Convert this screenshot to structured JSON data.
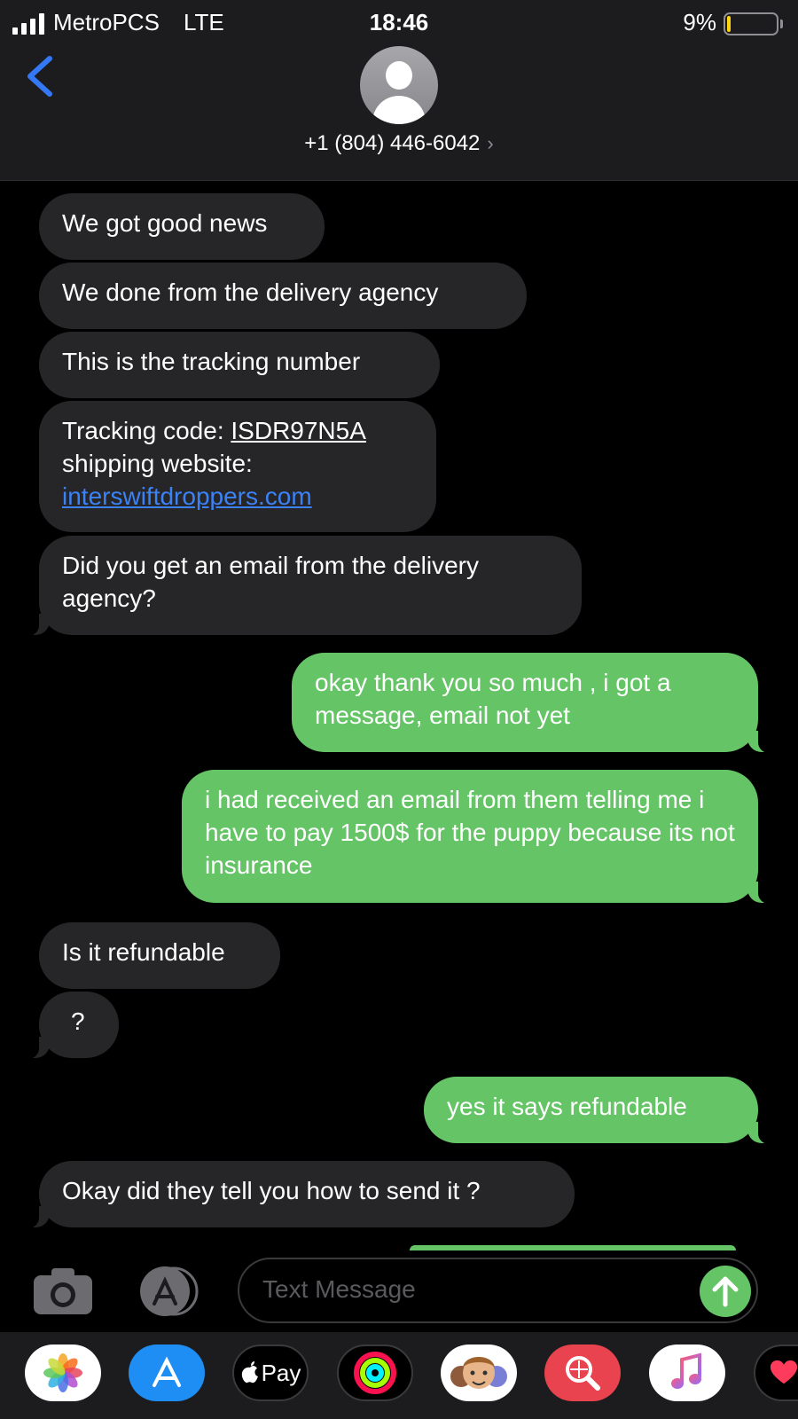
{
  "status_bar": {
    "carrier": "MetroPCS",
    "network": "LTE",
    "time": "18:46",
    "battery": "9%"
  },
  "contact": {
    "number": "+1 (804) 446-6042",
    "chevron": "›"
  },
  "messages": [
    {
      "direction": "incoming",
      "text": "We got good news"
    },
    {
      "direction": "incoming",
      "text": "We done from the delivery agency"
    },
    {
      "direction": "incoming",
      "text": "This is the tracking number"
    },
    {
      "direction": "incoming",
      "label": "Tracking code: ",
      "code": "ISDR97N5A",
      "line2": "shipping website:",
      "link": "interswiftdroppers.com"
    },
    {
      "direction": "incoming",
      "text": "Did you get an email from the delivery agency?"
    },
    {
      "direction": "outgoing",
      "text": "okay thank you so much , i got a message, email not yet"
    },
    {
      "direction": "outgoing",
      "text": "i had received an email from them telling me i have to pay 1500$ for the puppy because its not insurance"
    },
    {
      "direction": "incoming",
      "text": "Is it refundable"
    },
    {
      "direction": "incoming",
      "text": "?"
    },
    {
      "direction": "outgoing",
      "text": "yes it says refundable"
    },
    {
      "direction": "incoming",
      "text": "Okay did they tell you how to send it ?"
    }
  ],
  "compose": {
    "placeholder": "Text Message",
    "camera_icon": "camera-icon",
    "apps_icon": "app-store-icon",
    "send_icon": "arrow-up-icon"
  },
  "dock_apps": [
    {
      "name": "Photos",
      "icon": "photos-icon"
    },
    {
      "name": "App Store",
      "icon": "app-store-icon"
    },
    {
      "name": "Apple Pay",
      "icon": "apple-pay-icon",
      "label": "Pay"
    },
    {
      "name": "Activity",
      "icon": "activity-rings-icon"
    },
    {
      "name": "Memoji",
      "icon": "memoji-icon"
    },
    {
      "name": "Images",
      "icon": "image-search-icon"
    },
    {
      "name": "Music",
      "icon": "music-note-icon"
    },
    {
      "name": "Digital Touch",
      "icon": "heart-icon"
    }
  ],
  "colors": {
    "outgoing_bubble": "#65c466",
    "incoming_bubble": "#262628",
    "link": "#3b82f6",
    "back_arrow": "#3478f6",
    "battery_low": "#ffd60a"
  }
}
